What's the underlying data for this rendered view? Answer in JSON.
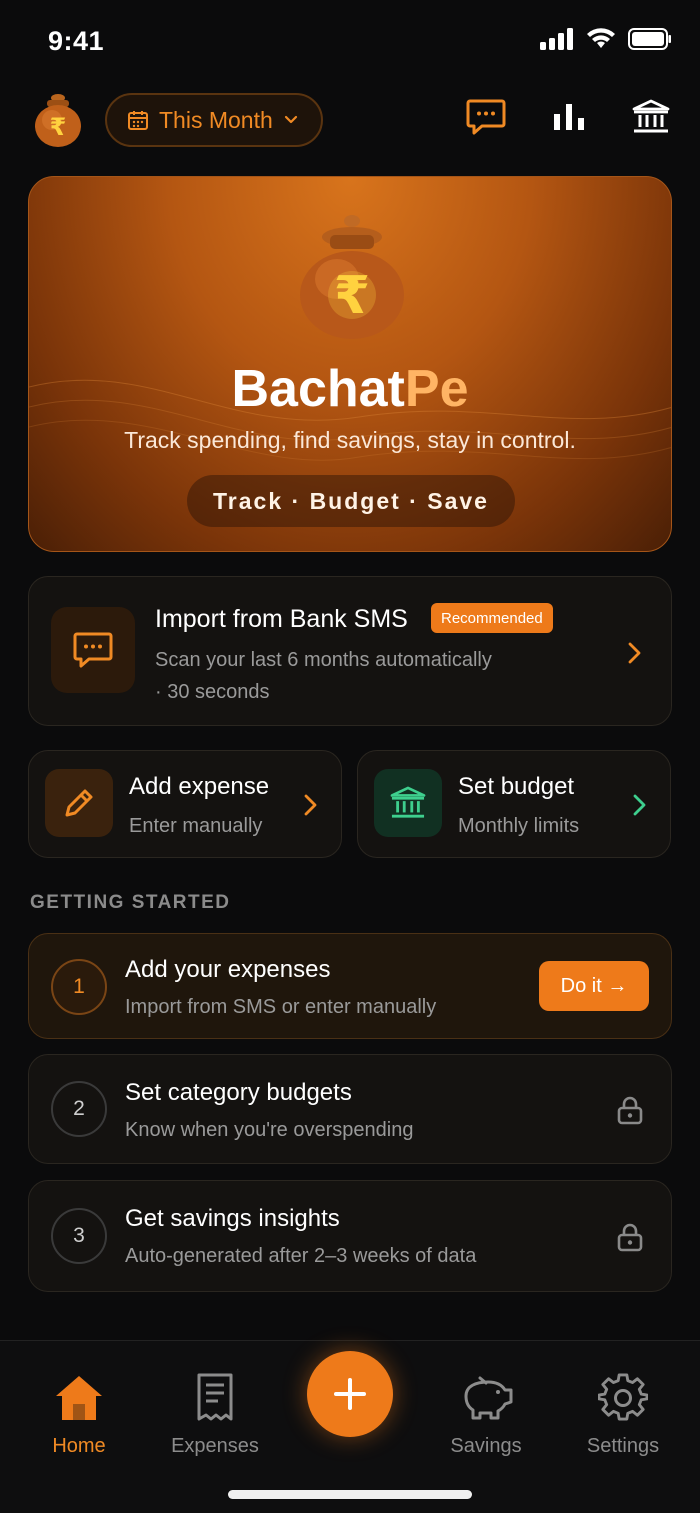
{
  "status": {
    "time": "9:41"
  },
  "header": {
    "period_label": "This Month"
  },
  "hero": {
    "title_part1": "Bachat",
    "title_part2": "Pe",
    "subtitle": "Track spending, find savings, stay in control.",
    "tagline": "Track · Budget · Save"
  },
  "sms_card": {
    "title": "Import from Bank SMS",
    "badge": "Recommended",
    "subtitle_line1": "Scan your last 6 months automatically",
    "subtitle_line2": "· 30 seconds"
  },
  "quick_actions": [
    {
      "title": "Add expense",
      "subtitle": "Enter manually"
    },
    {
      "title": "Set budget",
      "subtitle": "Monthly limits"
    }
  ],
  "getting_started": {
    "label": "GETTING STARTED",
    "steps": [
      {
        "number": "1",
        "title": "Add your expenses",
        "subtitle": "Import from SMS or enter manually",
        "action": "Do it →"
      },
      {
        "number": "2",
        "title": "Set category budgets",
        "subtitle": "Know when you're overspending"
      },
      {
        "number": "3",
        "title": "Get savings insights",
        "subtitle": "Auto-generated after 2–3 weeks of data"
      }
    ]
  },
  "nav": {
    "items": [
      "Home",
      "Expenses",
      "Savings",
      "Settings"
    ],
    "active": "Home"
  },
  "colors": {
    "accent": "#ee7a1a",
    "green": "#3ecf8e",
    "background": "#0b0b0c"
  }
}
